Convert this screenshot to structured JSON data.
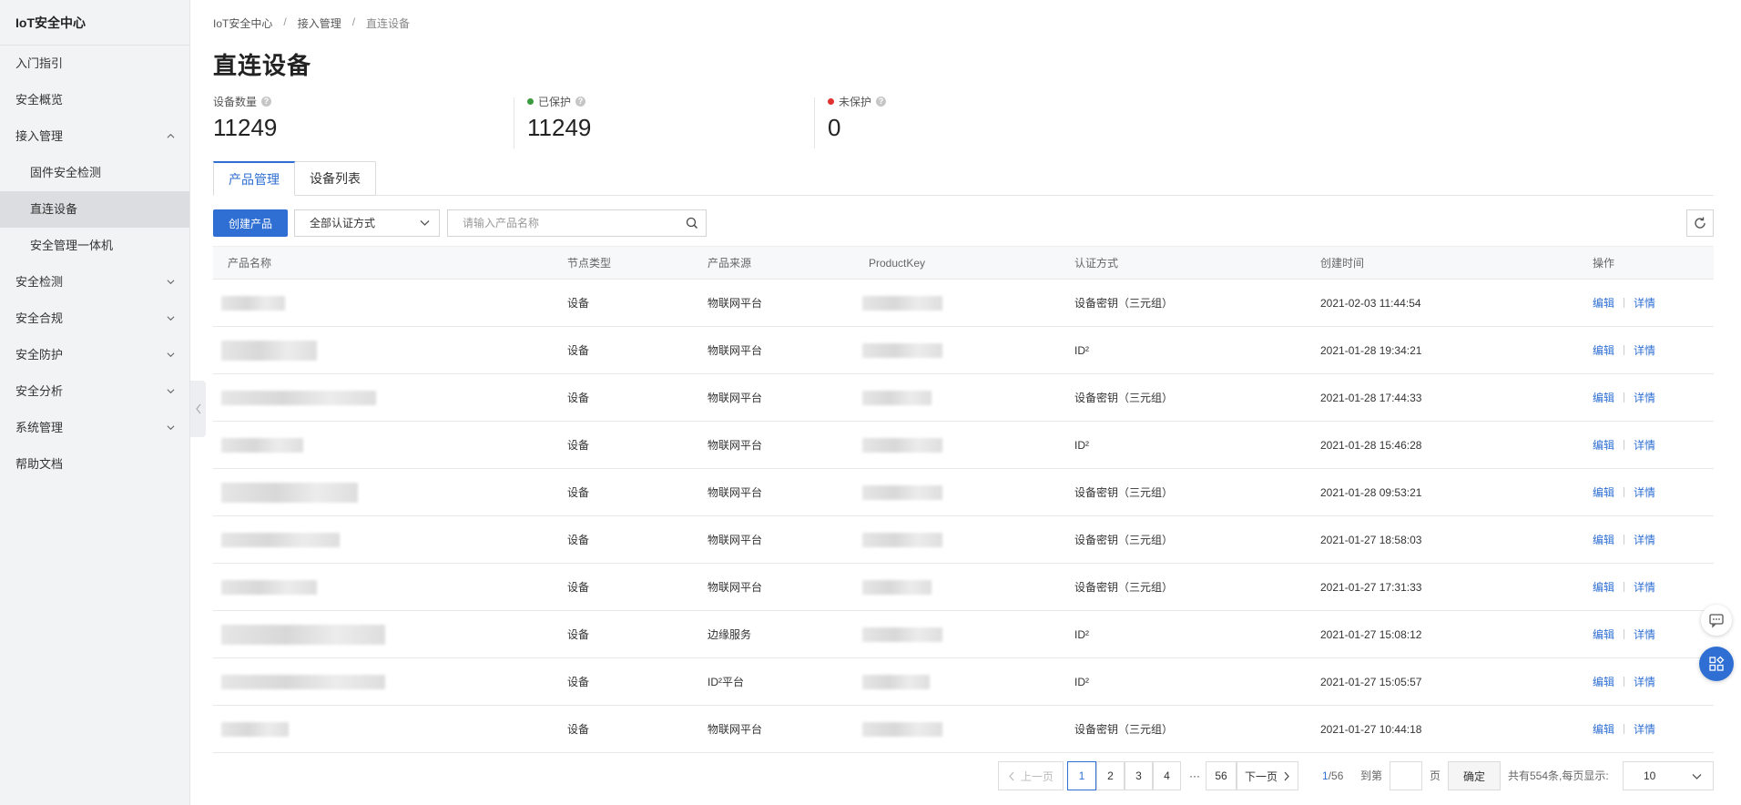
{
  "sidebar": {
    "title": "IoT安全中心",
    "items": [
      {
        "label": "入门指引",
        "type": "item"
      },
      {
        "label": "安全概览",
        "type": "item"
      },
      {
        "label": "接入管理",
        "type": "group",
        "expanded": true
      },
      {
        "label": "固件安全检测",
        "type": "sub"
      },
      {
        "label": "直连设备",
        "type": "sub",
        "active": true
      },
      {
        "label": "安全管理一体机",
        "type": "sub"
      },
      {
        "label": "安全检测",
        "type": "group",
        "expanded": false
      },
      {
        "label": "安全合规",
        "type": "group",
        "expanded": false
      },
      {
        "label": "安全防护",
        "type": "group",
        "expanded": false
      },
      {
        "label": "安全分析",
        "type": "group",
        "expanded": false
      },
      {
        "label": "系统管理",
        "type": "group",
        "expanded": false
      },
      {
        "label": "帮助文档",
        "type": "item"
      }
    ]
  },
  "breadcrumb": [
    "IoT安全中心",
    "接入管理",
    "直连设备"
  ],
  "page_title": "直连设备",
  "stats": [
    {
      "label": "设备数量",
      "value": "11249"
    },
    {
      "label": "已保护",
      "value": "11249",
      "dot_color": "#3a9c3e"
    },
    {
      "label": "未保护",
      "value": "0",
      "dot_color": "#e0332f"
    }
  ],
  "tabs": [
    "产品管理",
    "设备列表"
  ],
  "toolbar": {
    "create_label": "创建产品",
    "auth_select": "全部认证方式",
    "search_placeholder": "请输入产品名称"
  },
  "table": {
    "columns": [
      "产品名称",
      "节点类型",
      "产品来源",
      "ProductKey",
      "认证方式",
      "创建时间",
      "操作"
    ],
    "rows": [
      {
        "node": "设备",
        "source": "物联网平台",
        "auth": "设备密钥（三元组）",
        "time": "2021-02-03 11:44:54"
      },
      {
        "node": "设备",
        "source": "物联网平台",
        "auth": "ID²",
        "time": "2021-01-28 19:34:21"
      },
      {
        "node": "设备",
        "source": "物联网平台",
        "auth": "设备密钥（三元组）",
        "time": "2021-01-28 17:44:33"
      },
      {
        "node": "设备",
        "source": "物联网平台",
        "auth": "ID²",
        "time": "2021-01-28 15:46:28"
      },
      {
        "node": "设备",
        "source": "物联网平台",
        "auth": "设备密钥（三元组）",
        "time": "2021-01-28 09:53:21"
      },
      {
        "node": "设备",
        "source": "物联网平台",
        "auth": "设备密钥（三元组）",
        "time": "2021-01-27 18:58:03"
      },
      {
        "node": "设备",
        "source": "物联网平台",
        "auth": "设备密钥（三元组）",
        "time": "2021-01-27 17:31:33"
      },
      {
        "node": "设备",
        "source": "边缘服务",
        "auth": "ID²",
        "time": "2021-01-27 15:08:12"
      },
      {
        "node": "设备",
        "source": "ID²平台",
        "auth": "ID²",
        "time": "2021-01-27 15:05:57"
      },
      {
        "node": "设备",
        "source": "物联网平台",
        "auth": "设备密钥（三元组）",
        "time": "2021-01-27 10:44:18"
      }
    ],
    "op_edit": "编辑",
    "op_detail": "详情"
  },
  "pager": {
    "prev": "上一页",
    "pages": [
      "1",
      "2",
      "3",
      "4"
    ],
    "ellipsis": "···",
    "last_page": "56",
    "next": "下一页",
    "current_display": "1",
    "total_display": "/56",
    "goto_label": "到第",
    "page_unit": "页",
    "confirm": "确定",
    "summary": "共有554条,每页显示:",
    "page_size": "10"
  }
}
